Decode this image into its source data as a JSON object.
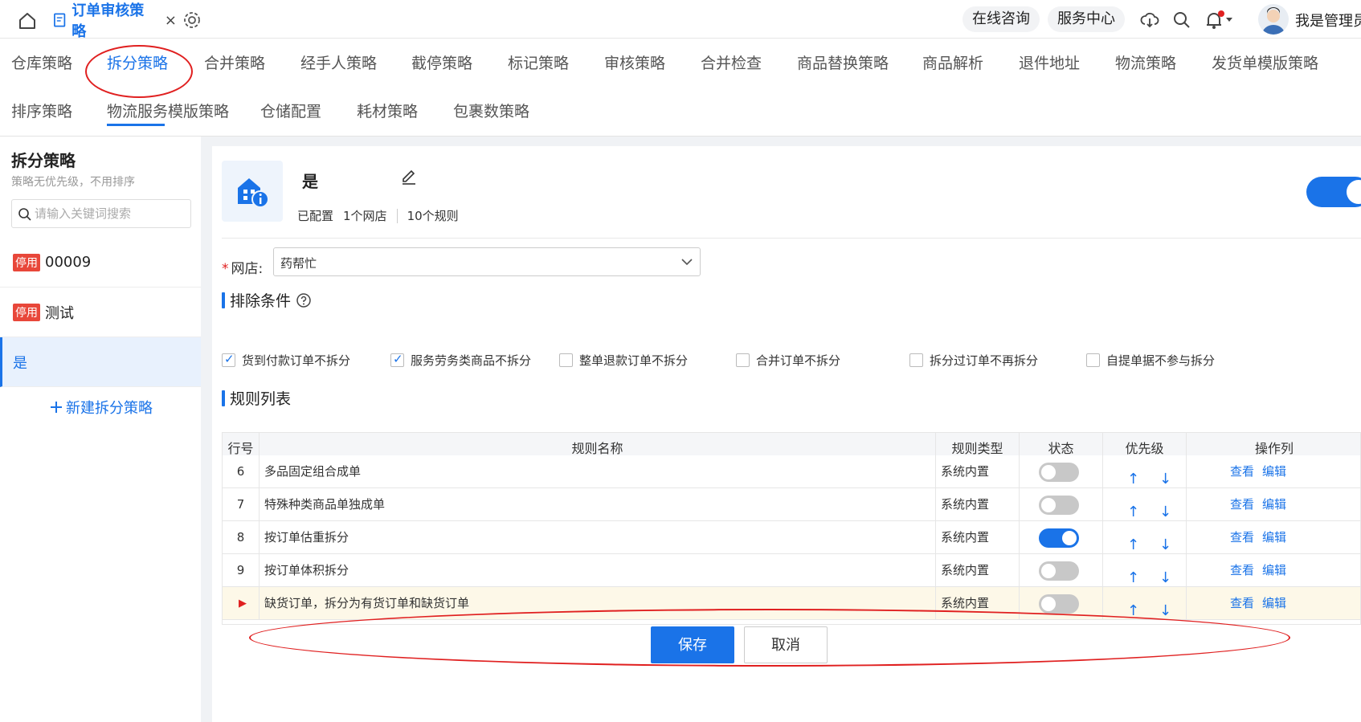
{
  "topbar": {
    "tab_title": "订单审核策略",
    "close": "×",
    "online_consult": "在线咨询",
    "service_center": "服务中心",
    "username": "我是管理员"
  },
  "nav": {
    "items": [
      "仓库策略",
      "拆分策略",
      "合并策略",
      "经手人策略",
      "截停策略",
      "标记策略",
      "审核策略",
      "合并检查",
      "商品替换策略",
      "商品解析",
      "退件地址",
      "物流策略",
      "发货单模版策略",
      "排序策略",
      "物流服务模版策略",
      "仓储配置",
      "耗材策略",
      "包裹数策略"
    ],
    "active": "拆分策略"
  },
  "sidebar": {
    "title": "拆分策略",
    "subtitle": "策略无优先级，不用排序",
    "search_placeholder": "请输入关键词搜索",
    "items": [
      {
        "badge": "停用",
        "name": "00009"
      },
      {
        "badge": "停用",
        "name": "测试"
      },
      {
        "badge": "",
        "name": "是"
      }
    ],
    "new_label": "新建拆分策略"
  },
  "policy": {
    "name": "是",
    "status": "已配置",
    "shops": "1个网店",
    "rules": "10个规则",
    "enabled": true
  },
  "shop": {
    "label": "网店:",
    "required": "*",
    "value": "药帮忙"
  },
  "exclude": {
    "title": "排除条件",
    "options": [
      {
        "label": "货到付款订单不拆分",
        "checked": true
      },
      {
        "label": "服务劳务类商品不拆分",
        "checked": true
      },
      {
        "label": "整单退款订单不拆分",
        "checked": false
      },
      {
        "label": "合并订单不拆分",
        "checked": false
      },
      {
        "label": "拆分过订单不再拆分",
        "checked": false
      },
      {
        "label": "自提单据不参与拆分",
        "checked": false
      }
    ]
  },
  "rules": {
    "title": "规则列表",
    "columns": [
      "行号",
      "规则名称",
      "规则类型",
      "状态",
      "优先级",
      "操作列"
    ],
    "rows": [
      {
        "no": "6",
        "name": "多品固定组合成单",
        "type": "系统内置",
        "on": false
      },
      {
        "no": "7",
        "name": "特殊种类商品单独成单",
        "type": "系统内置",
        "on": false
      },
      {
        "no": "8",
        "name": "按订单估重拆分",
        "type": "系统内置",
        "on": true
      },
      {
        "no": "9",
        "name": "按订单体积拆分",
        "type": "系统内置",
        "on": false
      },
      {
        "no": "",
        "name": "缺货订单，拆分为有货订单和缺货订单",
        "type": "系统内置",
        "on": false
      }
    ],
    "view": "查看",
    "edit": "编辑",
    "up": "↑",
    "down": "↓",
    "current_marker": "▶"
  },
  "actions": {
    "save": "保存",
    "cancel": "取消"
  },
  "colors": {
    "accent": "#1a73e8",
    "badge": "#e8473a",
    "annotation": "#e02020"
  }
}
